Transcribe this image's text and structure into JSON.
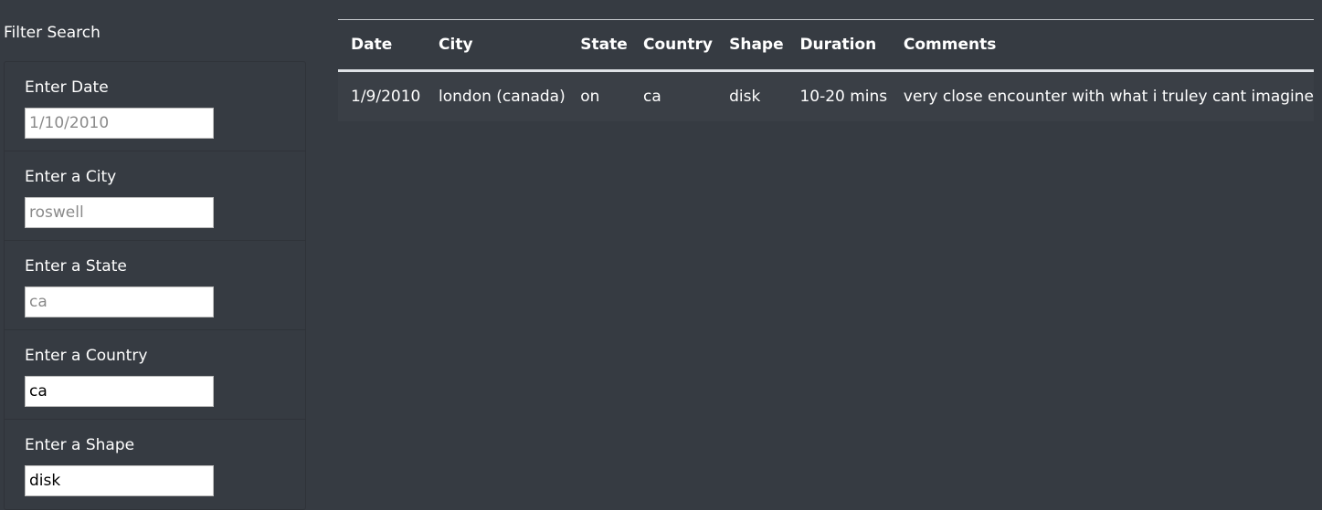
{
  "sidebar": {
    "title": "Filter Search",
    "filters": [
      {
        "label": "Enter Date",
        "value": "",
        "placeholder": "1/10/2010"
      },
      {
        "label": "Enter a City",
        "value": "",
        "placeholder": "roswell"
      },
      {
        "label": "Enter a State",
        "value": "",
        "placeholder": "ca"
      },
      {
        "label": "Enter a Country",
        "value": "ca",
        "placeholder": ""
      },
      {
        "label": "Enter a Shape",
        "value": "disk",
        "placeholder": ""
      }
    ]
  },
  "table": {
    "headers": [
      "Date",
      "City",
      "State",
      "Country",
      "Shape",
      "Duration",
      "Comments"
    ],
    "rows": [
      [
        "1/9/2010",
        "london (canada)",
        "on",
        "ca",
        "disk",
        "10-20 mins",
        "very close encounter with what i truley cant imagine"
      ]
    ]
  }
}
